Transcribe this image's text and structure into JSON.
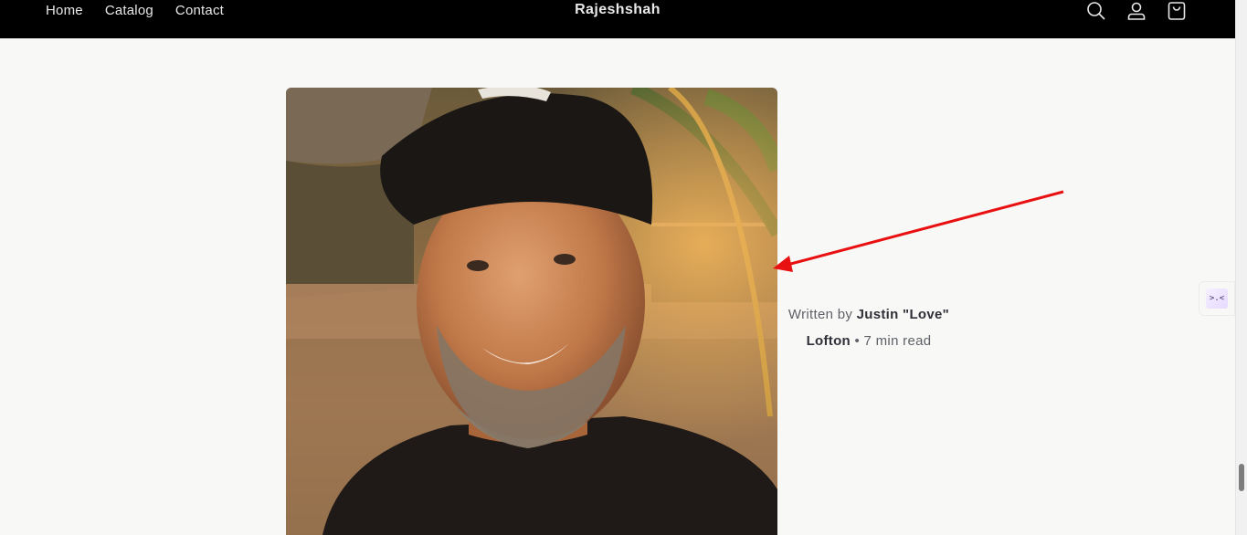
{
  "header": {
    "nav": [
      "Home",
      "Catalog",
      "Contact"
    ],
    "brand": "Rajeshshah",
    "icons": [
      "search-icon",
      "account-icon",
      "cart-icon"
    ]
  },
  "article": {
    "byline_prefix": "Written by ",
    "author": "Justin \"Love\" Lofton",
    "separator": " • ",
    "read_time": "7 min read"
  },
  "widget": {
    "glyph": ">.<"
  },
  "annotation": {
    "color": "#e81010"
  }
}
